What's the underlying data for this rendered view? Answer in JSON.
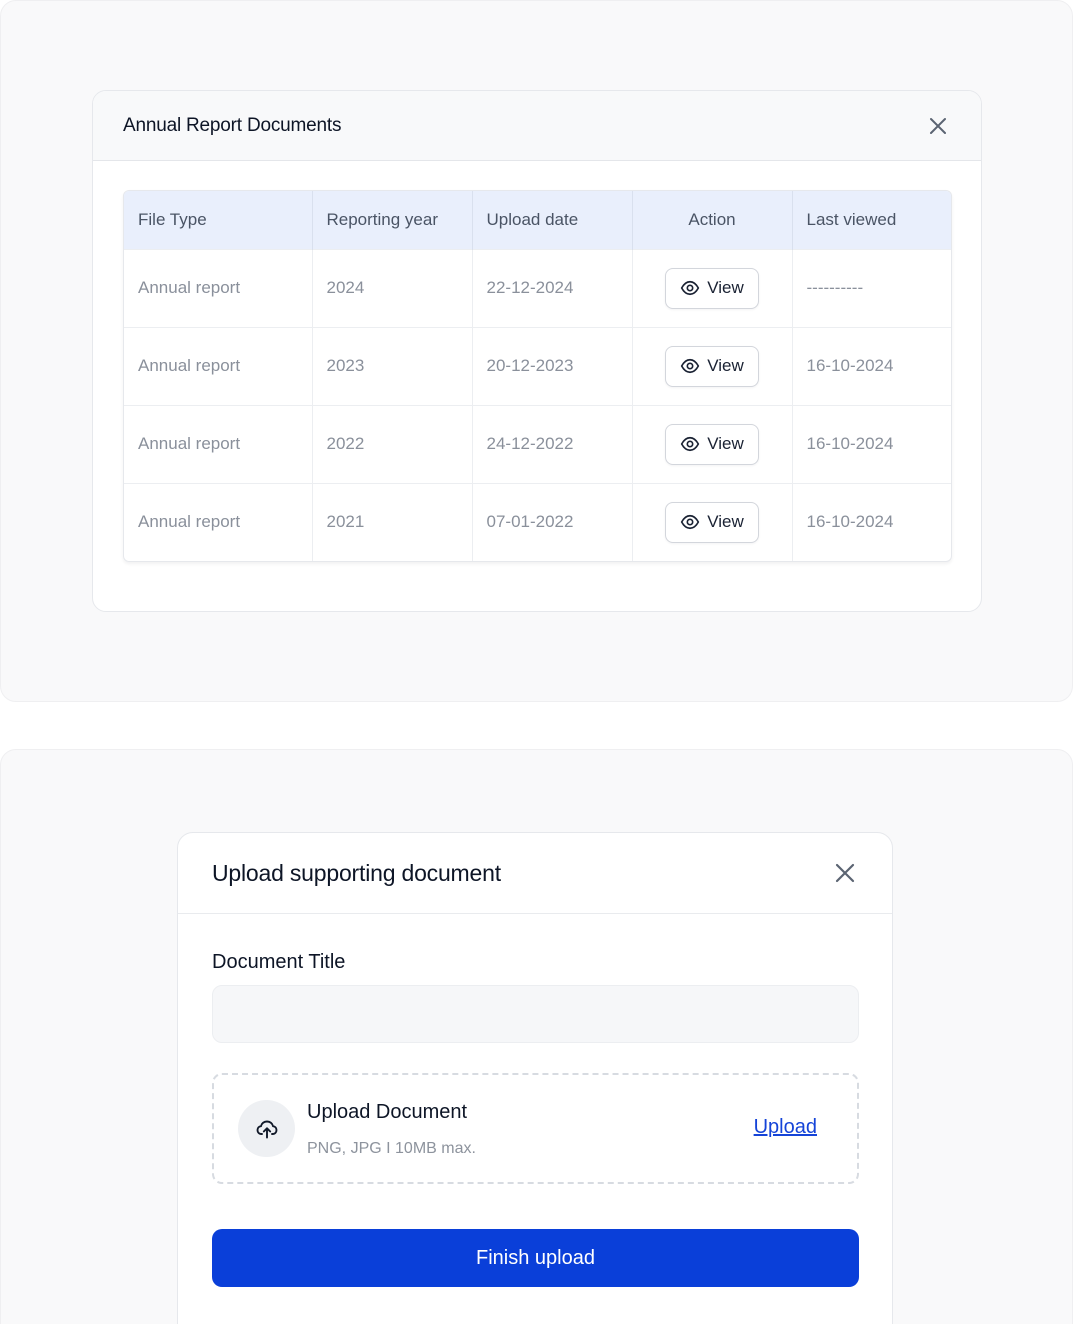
{
  "annual_modal": {
    "title": "Annual Report Documents",
    "columns": [
      "File Type",
      "Reporting year",
      "Upload date",
      "Action",
      "Last viewed"
    ],
    "rows": [
      {
        "file_type": "Annual report",
        "year": "2024",
        "upload_date": "22-12-2024",
        "action": "View",
        "last_viewed": "----------"
      },
      {
        "file_type": "Annual report",
        "year": "2023",
        "upload_date": "20-12-2023",
        "action": "View",
        "last_viewed": "16-10-2024"
      },
      {
        "file_type": "Annual report",
        "year": "2022",
        "upload_date": "24-12-2022",
        "action": "View",
        "last_viewed": "16-10-2024"
      },
      {
        "file_type": "Annual report",
        "year": "2021",
        "upload_date": "07-01-2022",
        "action": "View",
        "last_viewed": "16-10-2024"
      }
    ]
  },
  "upload_modal": {
    "title": "Upload supporting document",
    "field_label": "Document Title",
    "field_value": "",
    "field_placeholder": "",
    "dropzone_title": "Upload Document",
    "dropzone_hint": "PNG, JPG I 10MB max.",
    "upload_link": "Upload",
    "finish_button": "Finish upload"
  },
  "colors": {
    "primary": "#0a3fd9",
    "link": "#1544d8",
    "table_header_bg": "#e9effc"
  },
  "icons": {
    "close": "close-icon",
    "view": "eye-icon",
    "upload": "cloud-upload-icon"
  }
}
